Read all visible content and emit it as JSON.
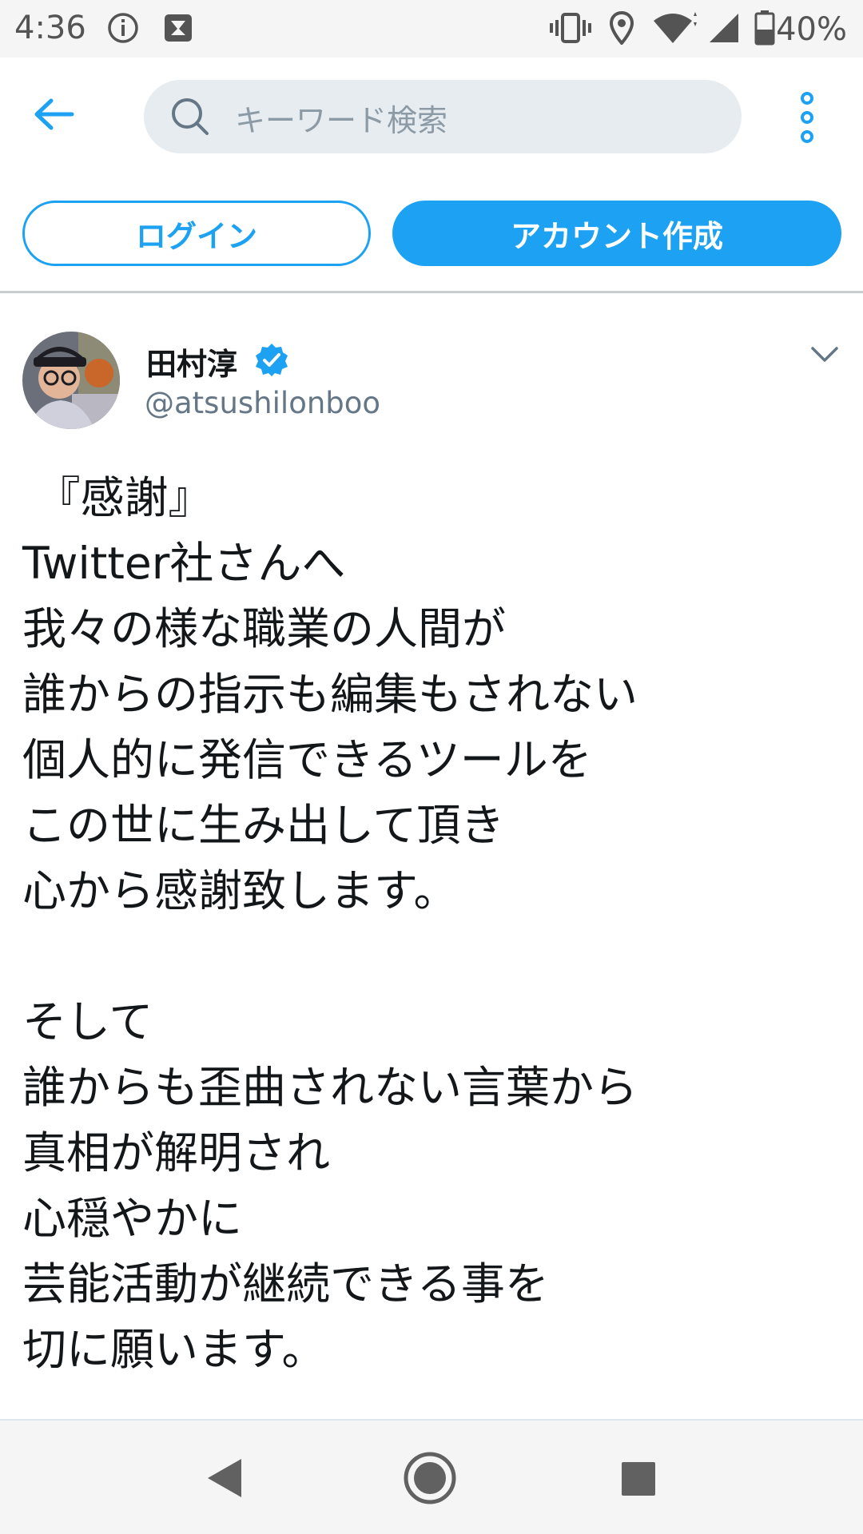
{
  "status_bar": {
    "time": "4:36",
    "battery": "40%",
    "icons": [
      "info-icon",
      "notification-icon",
      "vibrate-icon",
      "location-icon",
      "wifi-icon",
      "signal-icon",
      "battery-icon"
    ]
  },
  "header": {
    "search_placeholder": "キーワード検索",
    "icons": [
      "back-arrow-icon",
      "search-icon",
      "more-options-icon"
    ]
  },
  "auth": {
    "login_label": "ログイン",
    "signup_label": "アカウント作成"
  },
  "tweet": {
    "author_name": "田村淳",
    "handle": "@atsushilonboo",
    "verified": true,
    "body": " 『感謝』\nTwitter社さんへ\n我々の様な職業の人間が\n誰からの指示も編集もされない\n個人的に発信できるツールを\nこの世に生み出して頂き\n心から感謝致します。\n\nそして\n誰からも歪曲されない言葉から\n真相が解明され\n心穏やかに\n芸能活動が継続できる事を\n切に願います。"
  },
  "colors": {
    "accent": "#1da1f2",
    "text": "#14171a",
    "secondary_text": "#657786",
    "search_bg": "#e6ecf0"
  },
  "nav_bar": {
    "icons": [
      "nav-back-icon",
      "nav-home-icon",
      "nav-recents-icon"
    ]
  }
}
